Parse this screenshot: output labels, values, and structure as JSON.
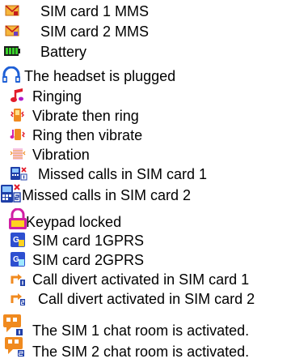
{
  "legend": {
    "items": [
      {
        "icon": "sim1-mms-envelope-icon",
        "label": "SIM card 1 MMS"
      },
      {
        "icon": "sim2-mms-envelope-icon",
        "label": "SIM card 2 MMS"
      },
      {
        "icon": "battery-icon",
        "label": "Battery"
      },
      {
        "icon": "headset-icon",
        "label": "The headset is plugged"
      },
      {
        "icon": "ringing-note-icon",
        "label": "Ringing"
      },
      {
        "icon": "vibrate-then-ring-icon",
        "label": "Vibrate then ring"
      },
      {
        "icon": "ring-then-vibrate-icon",
        "label": "Ring then vibrate"
      },
      {
        "icon": "vibration-icon",
        "label": "Vibration"
      },
      {
        "icon": "missed-calls-sim1-icon",
        "label": "Missed calls in SIM card 1"
      },
      {
        "icon": "missed-calls-sim2-icon",
        "label": "Missed calls in SIM card 2"
      },
      {
        "icon": "keypad-lock-icon",
        "label": "Keypad locked"
      },
      {
        "icon": "sim1-gprs-icon",
        "label": "SIM card 1GPRS"
      },
      {
        "icon": "sim2-gprs-icon",
        "label": "SIM card 2GPRS"
      },
      {
        "icon": "call-divert-sim1-icon",
        "label": "Call divert activated in SIM card 1"
      },
      {
        "icon": "call-divert-sim2-icon",
        "label": "Call divert activated in SIM card 2"
      },
      {
        "icon": "sim1-chat-room-icon",
        "label": "The SIM 1 chat room is activated."
      },
      {
        "icon": "sim2-chat-room-icon",
        "label": "The SIM 2 chat room is activated."
      }
    ]
  }
}
